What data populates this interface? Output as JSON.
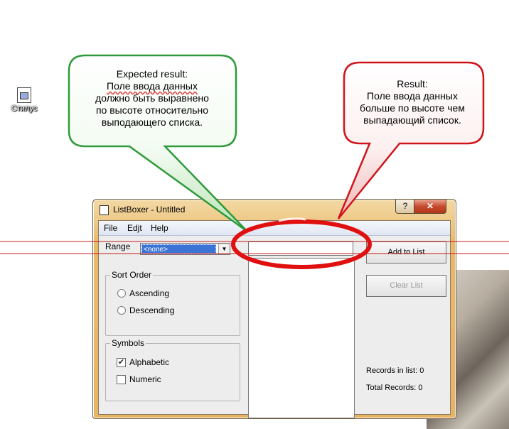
{
  "desktop": {
    "icon_caption": "Стилус"
  },
  "callouts": {
    "expected": {
      "heading": "Expected result:",
      "body_lines": [
        "Поле ввода данных",
        "должно быть выравнено",
        "по высоте относительно",
        "выподающего списка."
      ]
    },
    "actual": {
      "heading": "Result:",
      "body_lines": [
        "Поле ввода данных",
        "больше по высоте чем",
        "выпадающий список."
      ]
    }
  },
  "window": {
    "title": "ListBoxer - Untitled",
    "help_label": "?",
    "close_label": "✕",
    "menu": [
      "File",
      "Edjt",
      "Help"
    ],
    "range_label": "Range",
    "range_selected": "<none>",
    "entry_value": "",
    "add_button": "Add to List",
    "clear_button": "Clear List",
    "sort_group": {
      "title": "Sort Order",
      "options": [
        "Ascending",
        "Descending"
      ]
    },
    "symbols_group": {
      "title": "Symbols",
      "options": [
        {
          "label": "Alphabetic",
          "checked": true
        },
        {
          "label": "Numeric",
          "checked": false
        }
      ]
    },
    "records_in_list": "Records in list: 0",
    "total_records": "Total Records: 0"
  },
  "colors": {
    "callout_green": "#2e9a3a",
    "callout_red": "#d0141b",
    "ellipse_red": "#e01010"
  }
}
